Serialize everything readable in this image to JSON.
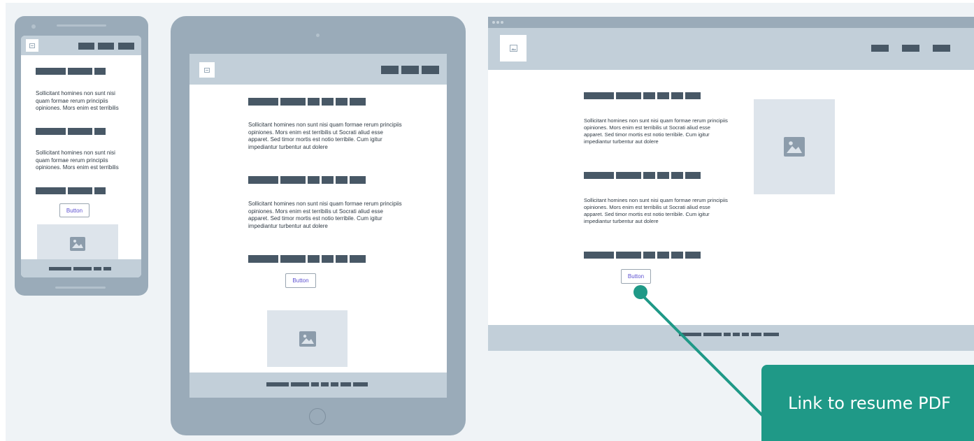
{
  "wireframe": {
    "paragraph_short": "Sollicitant homines non sunt nisi quam formae rerum principiis opiniones. Mors enim est terribilis",
    "paragraph_long": "Sollicitant homines non sunt nisi quam formae rerum principiis opiniones. Mors enim est terribilis ut Socrati aliud esse apparet. Sed timor mortis est notio terribile. Cum igitur impediantur turbentur aut dolere",
    "button_label": "Button",
    "icons": [
      "image-icon",
      "logo-icon"
    ]
  },
  "callout": {
    "text": "Link to resume PDF"
  },
  "colors": {
    "device_frame": "#9aabb9",
    "header": "#c2cfd9",
    "placeholder_bar": "#485866",
    "accent": "#1f9987",
    "button_text": "#5b4fd0"
  }
}
